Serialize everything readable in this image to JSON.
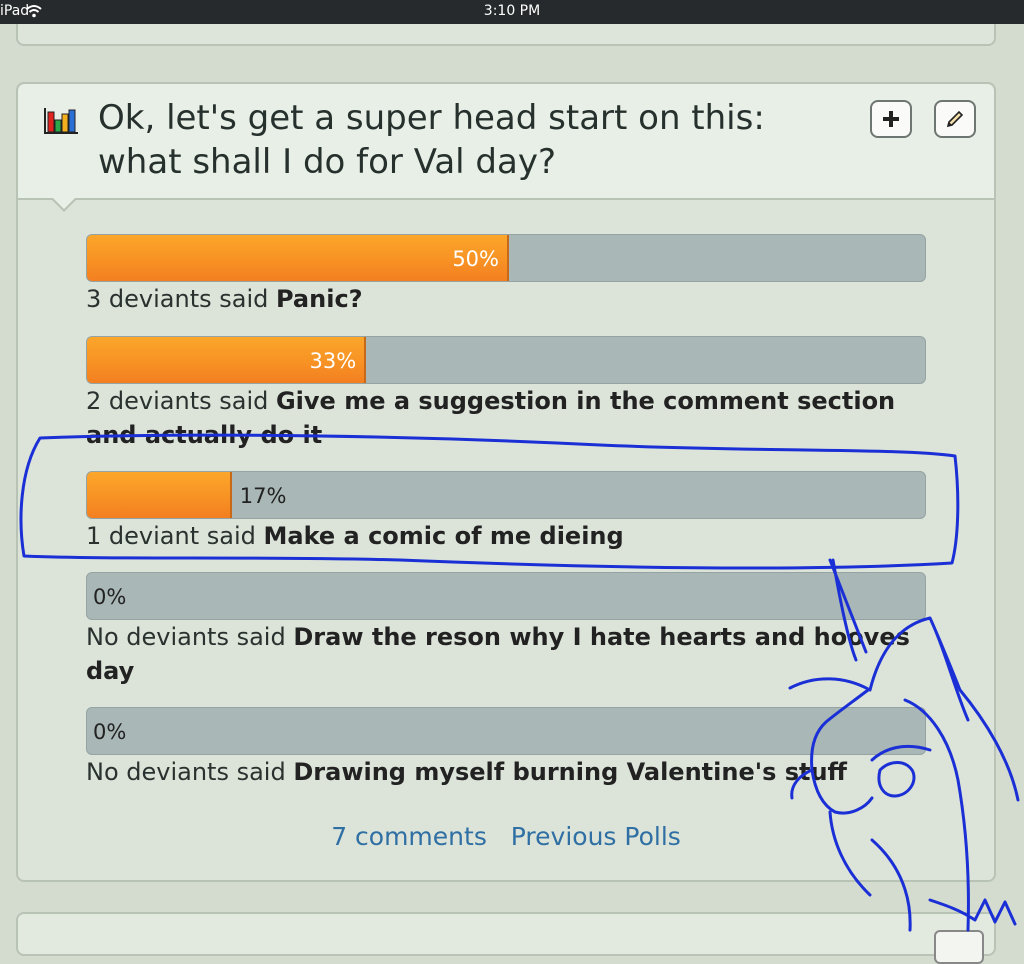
{
  "status_bar": {
    "device": "iPad",
    "time": "3:10 PM"
  },
  "poll": {
    "title": "Ok, let's get a super head start on this: what shall I do for Val day?",
    "options": [
      {
        "percent": 50,
        "percent_label": "50%",
        "count_text": "3 deviants said",
        "answer": "Panic?"
      },
      {
        "percent": 33,
        "percent_label": "33%",
        "count_text": "2 deviants said",
        "answer": "Give me a suggestion in the comment section and actually do it"
      },
      {
        "percent": 17,
        "percent_label": "17%",
        "count_text": "1 deviant said",
        "answer": "Make a comic of me dieing"
      },
      {
        "percent": 0,
        "percent_label": "0%",
        "count_text": "No deviants said",
        "answer": "Draw the reson why I hate hearts and hooves day"
      },
      {
        "percent": 0,
        "percent_label": "0%",
        "count_text": "No deviants said",
        "answer": "Drawing myself burning Valentine's stuff"
      }
    ],
    "links": {
      "comments": "7 comments",
      "previous": "Previous Polls"
    }
  },
  "icons": {
    "poll": "bar-chart-icon",
    "add": "plus-icon",
    "edit": "pencil-icon",
    "wifi": "wifi-icon"
  },
  "colors": {
    "bar_fill": "#f89424",
    "bar_track": "#a9b7b6",
    "link": "#2f6fa3",
    "annotation": "#1b2fd6"
  }
}
